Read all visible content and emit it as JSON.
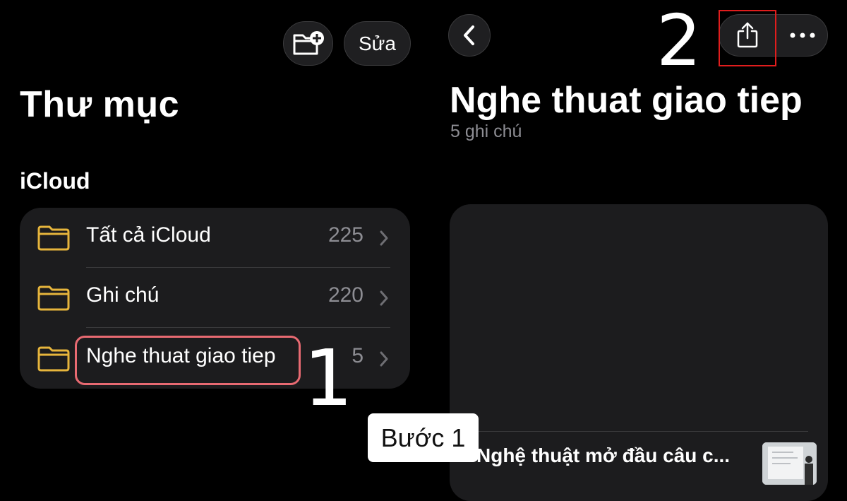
{
  "left_pane": {
    "edit_label": "Sửa",
    "title": "Thư mục",
    "section": "iCloud",
    "folders": [
      {
        "label": "Tất cả iCloud",
        "count": "225"
      },
      {
        "label": "Ghi chú",
        "count": "220"
      },
      {
        "label": "Nghe thuat giao tiep",
        "count": "5"
      }
    ]
  },
  "right_pane": {
    "folder_title": "Nghe thuat giao tiep",
    "note_count": "5 ghi chú",
    "notes": [
      {
        "title": "Nghệ thuật mở đầu câu c..."
      }
    ]
  },
  "annotations": {
    "step1_marker": "1",
    "step2_marker": "2",
    "step_label": "Bước 1"
  },
  "icons": {
    "new_folder": "folder-plus-icon",
    "folder": "folder-icon",
    "chevron": "chevron-right-icon",
    "back": "chevron-left-icon",
    "share": "share-icon",
    "more": "ellipsis-icon"
  },
  "colors": {
    "folder_icon": "#e6b53c",
    "highlight_row": "#e86a72",
    "highlight_share": "#e01d1d",
    "background": "#000000",
    "card": "#1c1c1e",
    "secondary_text": "#8d8d93"
  }
}
